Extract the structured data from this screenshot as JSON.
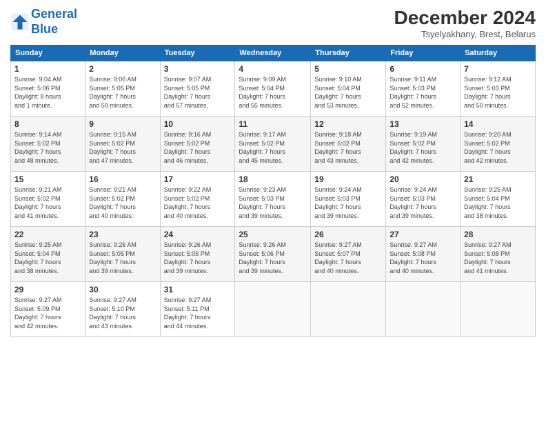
{
  "header": {
    "logo_line1": "General",
    "logo_line2": "Blue",
    "title": "December 2024",
    "subtitle": "Tsyelyakhany, Brest, Belarus"
  },
  "calendar": {
    "days_of_week": [
      "Sunday",
      "Monday",
      "Tuesday",
      "Wednesday",
      "Thursday",
      "Friday",
      "Saturday"
    ],
    "weeks": [
      [
        {
          "day": "1",
          "info": "Sunrise: 9:04 AM\nSunset: 5:06 PM\nDaylight: 8 hours\nand 1 minute."
        },
        {
          "day": "2",
          "info": "Sunrise: 9:06 AM\nSunset: 5:05 PM\nDaylight: 7 hours\nand 59 minutes."
        },
        {
          "day": "3",
          "info": "Sunrise: 9:07 AM\nSunset: 5:05 PM\nDaylight: 7 hours\nand 57 minutes."
        },
        {
          "day": "4",
          "info": "Sunrise: 9:09 AM\nSunset: 5:04 PM\nDaylight: 7 hours\nand 55 minutes."
        },
        {
          "day": "5",
          "info": "Sunrise: 9:10 AM\nSunset: 5:04 PM\nDaylight: 7 hours\nand 53 minutes."
        },
        {
          "day": "6",
          "info": "Sunrise: 9:11 AM\nSunset: 5:03 PM\nDaylight: 7 hours\nand 52 minutes."
        },
        {
          "day": "7",
          "info": "Sunrise: 9:12 AM\nSunset: 5:03 PM\nDaylight: 7 hours\nand 50 minutes."
        }
      ],
      [
        {
          "day": "8",
          "info": "Sunrise: 9:14 AM\nSunset: 5:02 PM\nDaylight: 7 hours\nand 48 minutes."
        },
        {
          "day": "9",
          "info": "Sunrise: 9:15 AM\nSunset: 5:02 PM\nDaylight: 7 hours\nand 47 minutes."
        },
        {
          "day": "10",
          "info": "Sunrise: 9:16 AM\nSunset: 5:02 PM\nDaylight: 7 hours\nand 46 minutes."
        },
        {
          "day": "11",
          "info": "Sunrise: 9:17 AM\nSunset: 5:02 PM\nDaylight: 7 hours\nand 45 minutes."
        },
        {
          "day": "12",
          "info": "Sunrise: 9:18 AM\nSunset: 5:02 PM\nDaylight: 7 hours\nand 43 minutes."
        },
        {
          "day": "13",
          "info": "Sunrise: 9:19 AM\nSunset: 5:02 PM\nDaylight: 7 hours\nand 42 minutes."
        },
        {
          "day": "14",
          "info": "Sunrise: 9:20 AM\nSunset: 5:02 PM\nDaylight: 7 hours\nand 42 minutes."
        }
      ],
      [
        {
          "day": "15",
          "info": "Sunrise: 9:21 AM\nSunset: 5:02 PM\nDaylight: 7 hours\nand 41 minutes."
        },
        {
          "day": "16",
          "info": "Sunrise: 9:21 AM\nSunset: 5:02 PM\nDaylight: 7 hours\nand 40 minutes."
        },
        {
          "day": "17",
          "info": "Sunrise: 9:22 AM\nSunset: 5:02 PM\nDaylight: 7 hours\nand 40 minutes."
        },
        {
          "day": "18",
          "info": "Sunrise: 9:23 AM\nSunset: 5:03 PM\nDaylight: 7 hours\nand 39 minutes."
        },
        {
          "day": "19",
          "info": "Sunrise: 9:24 AM\nSunset: 5:03 PM\nDaylight: 7 hours\nand 39 minutes."
        },
        {
          "day": "20",
          "info": "Sunrise: 9:24 AM\nSunset: 5:03 PM\nDaylight: 7 hours\nand 39 minutes."
        },
        {
          "day": "21",
          "info": "Sunrise: 9:25 AM\nSunset: 5:04 PM\nDaylight: 7 hours\nand 38 minutes."
        }
      ],
      [
        {
          "day": "22",
          "info": "Sunrise: 9:25 AM\nSunset: 5:04 PM\nDaylight: 7 hours\nand 38 minutes."
        },
        {
          "day": "23",
          "info": "Sunrise: 9:26 AM\nSunset: 5:05 PM\nDaylight: 7 hours\nand 39 minutes."
        },
        {
          "day": "24",
          "info": "Sunrise: 9:26 AM\nSunset: 5:05 PM\nDaylight: 7 hours\nand 39 minutes."
        },
        {
          "day": "25",
          "info": "Sunrise: 9:26 AM\nSunset: 5:06 PM\nDaylight: 7 hours\nand 39 minutes."
        },
        {
          "day": "26",
          "info": "Sunrise: 9:27 AM\nSunset: 5:07 PM\nDaylight: 7 hours\nand 40 minutes."
        },
        {
          "day": "27",
          "info": "Sunrise: 9:27 AM\nSunset: 5:08 PM\nDaylight: 7 hours\nand 40 minutes."
        },
        {
          "day": "28",
          "info": "Sunrise: 9:27 AM\nSunset: 5:08 PM\nDaylight: 7 hours\nand 41 minutes."
        }
      ],
      [
        {
          "day": "29",
          "info": "Sunrise: 9:27 AM\nSunset: 5:09 PM\nDaylight: 7 hours\nand 42 minutes."
        },
        {
          "day": "30",
          "info": "Sunrise: 9:27 AM\nSunset: 5:10 PM\nDaylight: 7 hours\nand 43 minutes."
        },
        {
          "day": "31",
          "info": "Sunrise: 9:27 AM\nSunset: 5:11 PM\nDaylight: 7 hours\nand 44 minutes."
        },
        {
          "day": "",
          "info": ""
        },
        {
          "day": "",
          "info": ""
        },
        {
          "day": "",
          "info": ""
        },
        {
          "day": "",
          "info": ""
        }
      ]
    ]
  }
}
